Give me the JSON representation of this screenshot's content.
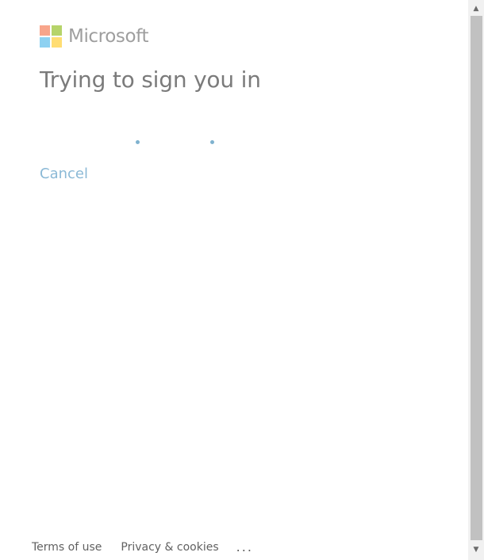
{
  "brand": {
    "name": "Microsoft",
    "logo_colors": [
      "#f8a58b",
      "#b6d46a",
      "#8ed1f1",
      "#ffdd73"
    ]
  },
  "main": {
    "title": "Trying to sign you in",
    "cancel_label": "Cancel"
  },
  "footer": {
    "terms_label": "Terms of use",
    "privacy_label": "Privacy & cookies",
    "more_label": "..."
  },
  "scrollbar": {
    "up_icon": "▲",
    "down_icon": "▼"
  },
  "colors": {
    "title": "#7b7b7b",
    "link": "#8bb9d6",
    "progress_dot": "#7fb2cf"
  }
}
